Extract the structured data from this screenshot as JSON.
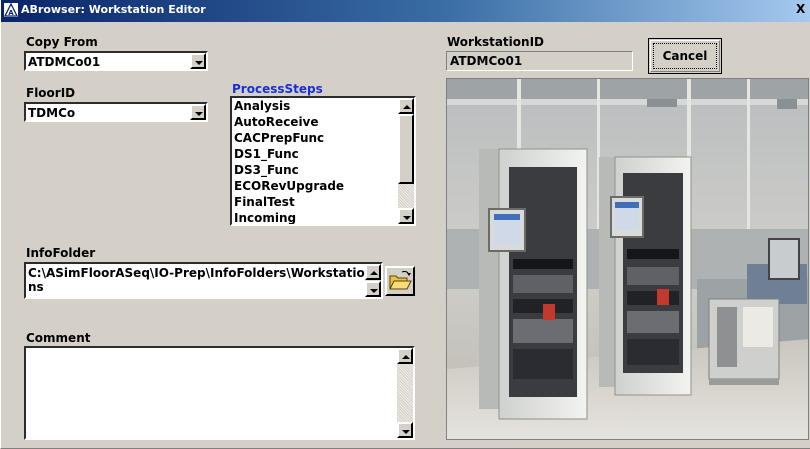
{
  "window": {
    "title": "ABrowser: Workstation Editor",
    "close_glyph": "X"
  },
  "copy_from": {
    "label": "Copy From",
    "value": "ATDMCo01"
  },
  "floor_id": {
    "label": "FloorID",
    "value": "TDMCo"
  },
  "process_steps": {
    "label": "ProcessSteps",
    "items": [
      "Analysis",
      "AutoReceive",
      "CACPrepFunc",
      "DS1_Func",
      "DS3_Func",
      "ECORevUpgrade",
      "FinalTest",
      "Incoming"
    ]
  },
  "workstation_id": {
    "label": "WorkstationID",
    "value": "ATDMCo01"
  },
  "cancel_button": {
    "label": "Cancel"
  },
  "info_folder": {
    "label": "InfoFolder",
    "value": "C:\\ASimFloorASeq\\IO-Prep\\InfoFolders\\Workstations"
  },
  "comment": {
    "label": "Comment",
    "value": ""
  },
  "icons": {
    "app": "abrowser-app-icon",
    "folder": "open-folder-icon",
    "photo": "workstation-photo"
  },
  "colors": {
    "title_start": "#0a246a",
    "title_end": "#a6caf0",
    "dialog_face": "#d4d0c8",
    "process_steps_label": "#1a2fd6"
  }
}
